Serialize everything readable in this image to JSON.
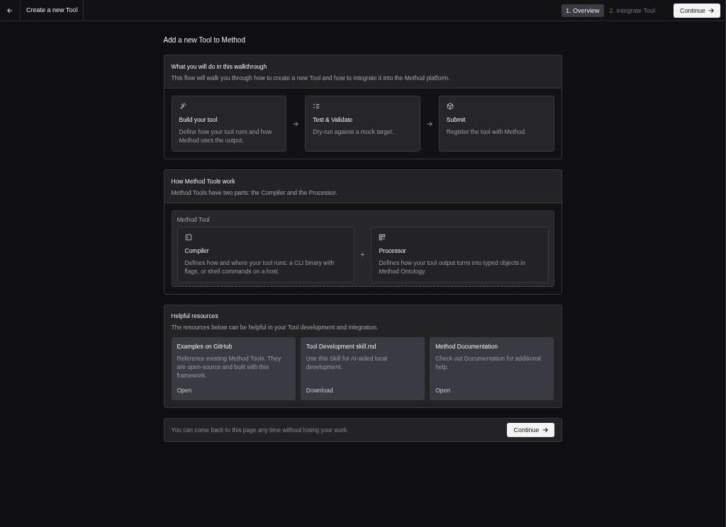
{
  "header": {
    "title": "Create a new Tool",
    "steps": [
      {
        "label": "1. Overview",
        "selected": true
      },
      {
        "label": "2. Integrate Tool",
        "selected": false
      }
    ],
    "continue_label": "Continue"
  },
  "page_title": "Add a new Tool to Method",
  "walkthrough": {
    "title": "What you will do in this walkthrough",
    "description": "This flow will walk you through how to create a new Tool and how to integrate it into the Method platform.",
    "steps": [
      {
        "title": "Build your tool",
        "description": "Define how your tool runs and how Method uses the output."
      },
      {
        "title": "Test & Validate",
        "description": "Dry-run against a mock target."
      },
      {
        "title": "Submit",
        "description": "Register the tool with Method."
      }
    ]
  },
  "how_it_works": {
    "title": "How Method Tools work",
    "description": "Method Tools have two parts: the Compiler and the Processor.",
    "group_label": "Method Tool",
    "joiner": "+",
    "parts": [
      {
        "title": "Compiler",
        "description": "Defines how and where your tool runs: a CLI binary with flags, or shell commands on a host."
      },
      {
        "title": "Processor",
        "description": "Defines how your tool output turns into typed objects in Method Ontology."
      }
    ]
  },
  "resources": {
    "title": "Helpful resources",
    "description": "The resources below can be helpful in your Tool development and integration.",
    "items": [
      {
        "title": "Examples on GitHub",
        "description": "Reference existing Method Tools. They are open-source and built with this framework.",
        "action": "Open"
      },
      {
        "title": "Tool Development skill.md",
        "description": "Use this Skill for AI-aided local development.",
        "action": "Download"
      },
      {
        "title": "Method Documentation",
        "description": "Check out Documentation for additional help.",
        "action": "Open"
      }
    ]
  },
  "footer": {
    "note": "You can come back to this page any time without losing your work.",
    "continue_label": "Continue"
  }
}
